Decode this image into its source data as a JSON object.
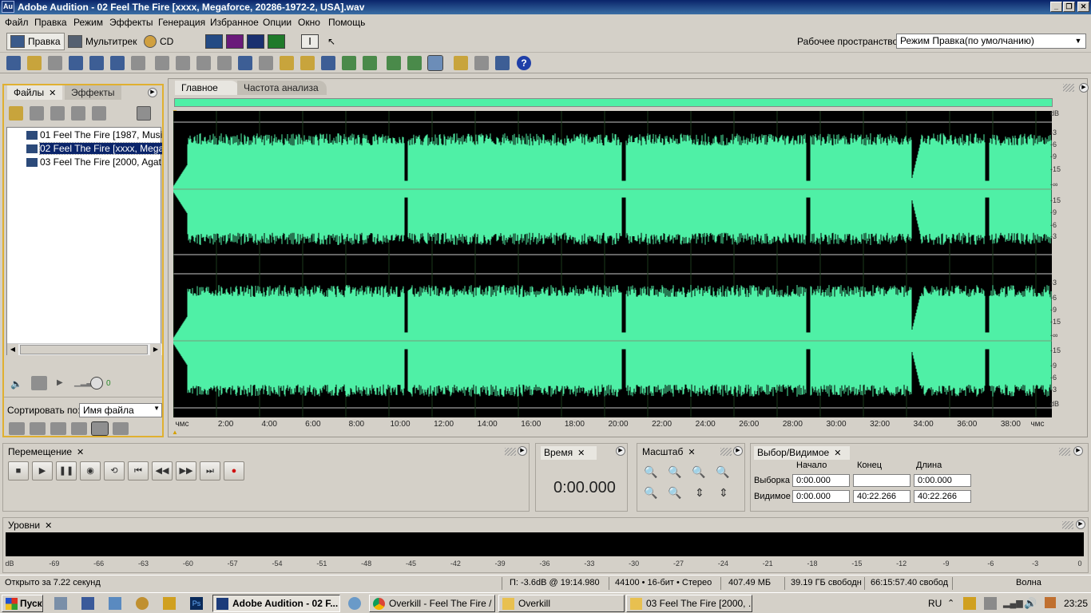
{
  "title_bar": {
    "app_icon": "Au",
    "title": "Adobe Audition - 02 Feel The Fire [xxxx, Megaforce, 20286-1972-2, USA].wav"
  },
  "menu": [
    "Файл",
    "Правка",
    "Режим",
    "Эффекты",
    "Генерация",
    "Избранное",
    "Опции",
    "Окно",
    "Помощь"
  ],
  "modes": {
    "edit": "Правка",
    "multitrack": "Мультитрек",
    "cd": "CD"
  },
  "workspace": {
    "label": "Рабочее пространство:",
    "value": "Режим Правка(по умолчанию)"
  },
  "files_panel": {
    "tabs": [
      "Файлы",
      "Эффекты"
    ],
    "files": [
      "01 Feel The Fire [1987, Music Fo",
      "02 Feel The Fire [xxxx, Megaforce",
      "03 Feel The Fire [2000, Agat, Un"
    ],
    "selected_index": 1,
    "volume": "0",
    "sort_label": "Сортировать по:",
    "sort_value": "Имя файла"
  },
  "editor": {
    "tabs": [
      "Главное",
      "Частота анализа"
    ],
    "wave_color": "#4ff0a6",
    "db_labels_top": [
      "dB",
      "-3",
      "-6",
      "-9",
      "-15",
      "-∞",
      "-15",
      "-9",
      "-6",
      "-3"
    ],
    "db_labels_bottom": [
      "-3",
      "-6",
      "-9",
      "-15",
      "-∞",
      "-15",
      "-9",
      "-6",
      "-3",
      "dB"
    ],
    "timeline": [
      "чмс",
      "2:00",
      "4:00",
      "6:00",
      "8:00",
      "10:00",
      "12:00",
      "14:00",
      "16:00",
      "18:00",
      "20:00",
      "22:00",
      "24:00",
      "26:00",
      "28:00",
      "30:00",
      "32:00",
      "34:00",
      "36:00",
      "38:00",
      "чмс"
    ]
  },
  "transport": {
    "title": "Перемещение"
  },
  "time_panel": {
    "title": "Время",
    "value": "0:00.000"
  },
  "zoom_panel": {
    "title": "Масштаб"
  },
  "selection_panel": {
    "title": "Выбор/Видимое",
    "col_start": "Начало",
    "col_end": "Конец",
    "col_length": "Длина",
    "row_selection": "Выборка",
    "row_view": "Видимое",
    "sel_start": "0:00.000",
    "sel_end": "",
    "sel_length": "0:00.000",
    "view_start": "0:00.000",
    "view_end": "40:22.266",
    "view_length": "40:22.266"
  },
  "levels_panel": {
    "title": "Уровни",
    "scale": [
      "dB",
      "-69",
      "-66",
      "-63",
      "-60",
      "-57",
      "-54",
      "-51",
      "-48",
      "-45",
      "-42",
      "-39",
      "-36",
      "-33",
      "-30",
      "-27",
      "-24",
      "-21",
      "-18",
      "-15",
      "-12",
      "-9",
      "-6",
      "-3",
      "0"
    ]
  },
  "status": {
    "opened": "Открыто за 7.22 секунд",
    "peak": "П: -3.6dB @ 19:14.980",
    "format": "44100 • 16-бит • Стерео",
    "size": "407.49 МБ",
    "free": "39.19 ГБ свободн",
    "free_time": "66:15:57.40 свобод",
    "mode": "Волна"
  },
  "taskbar": {
    "start": "Пуск",
    "windows": [
      "Adobe Audition - 02 F...",
      "Overkill - Feel The Fire / ...",
      "Overkill",
      "03 Feel The Fire [2000, ..."
    ],
    "lang": "RU",
    "clock": "23:25"
  }
}
